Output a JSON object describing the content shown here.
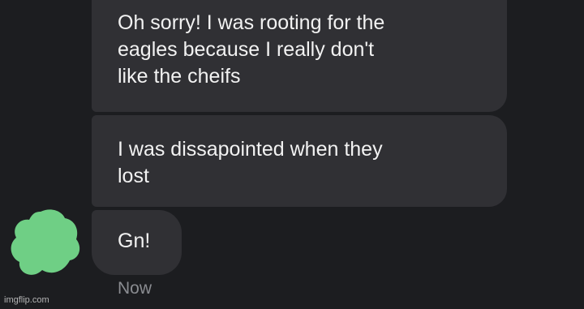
{
  "messages": [
    {
      "text": "Oh sorry! I was rooting for the\neagles because I really don't\nlike the cheifs"
    },
    {
      "text": "I was dissapointed when they\nlost"
    },
    {
      "text": "Gn!"
    }
  ],
  "timestamp": "Now",
  "watermark": "imgflip.com",
  "colors": {
    "background": "#1c1d20",
    "bubble": "#303034",
    "text": "#f2f2f2",
    "timestamp": "#8a8c91",
    "avatar_blob": "#6fcf85"
  }
}
